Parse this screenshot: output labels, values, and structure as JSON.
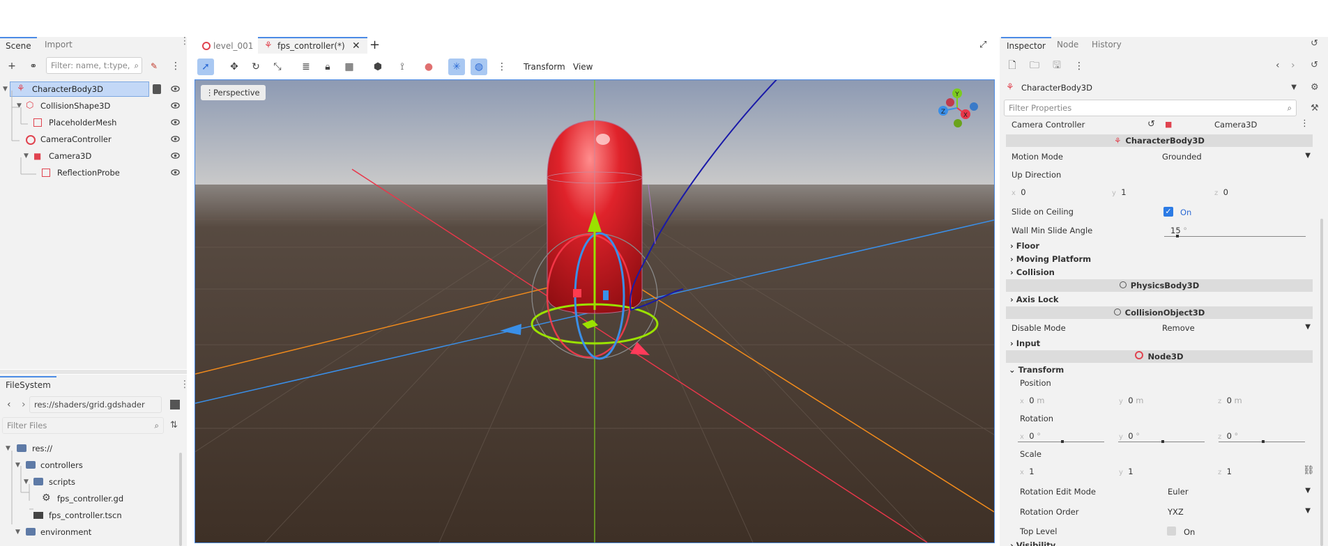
{
  "scene_dock": {
    "tabs": [
      "Scene",
      "Import"
    ],
    "filter_placeholder": "Filter: name, t:type,",
    "nodes": [
      {
        "name": "CharacterBody3D",
        "icon": "character-body-icon",
        "selected": true
      },
      {
        "name": "CollisionShape3D",
        "icon": "collision-shape-icon"
      },
      {
        "name": "PlaceholderMesh",
        "icon": "mesh-icon"
      },
      {
        "name": "CameraController",
        "icon": "node3d-icon"
      },
      {
        "name": "Camera3D",
        "icon": "camera-icon"
      },
      {
        "name": "ReflectionProbe",
        "icon": "reflection-probe-icon"
      }
    ]
  },
  "filesystem": {
    "tab": "FileSystem",
    "path": "res://shaders/grid.gdshader",
    "filter_placeholder": "Filter Files",
    "items": [
      {
        "name": "res://",
        "type": "folder"
      },
      {
        "name": "controllers",
        "type": "folder"
      },
      {
        "name": "scripts",
        "type": "folder"
      },
      {
        "name": "fps_controller.gd",
        "type": "script"
      },
      {
        "name": "fps_controller.tscn",
        "type": "scene"
      },
      {
        "name": "environment",
        "type": "folder"
      }
    ]
  },
  "editor_tabs": {
    "tabs": [
      "level_001",
      "fps_controller(*)"
    ],
    "active": 1
  },
  "viewport_toolbar": {
    "transform_menu": "Transform",
    "view_menu": "View",
    "perspective_label": "Perspective"
  },
  "gizmo_labels": {
    "x": "X",
    "y": "Y",
    "z": "Z"
  },
  "inspector": {
    "tabs": [
      "Inspector",
      "Node",
      "History"
    ],
    "object_name": "CharacterBody3D",
    "filter_placeholder": "Filter Properties",
    "camera_controller": {
      "label": "Camera Controller",
      "value": "Camera3D"
    },
    "sections": {
      "character_body": "CharacterBody3D",
      "physics_body": "PhysicsBody3D",
      "collision_object": "CollisionObject3D",
      "node3d": "Node3D"
    },
    "motion_mode": {
      "label": "Motion Mode",
      "value": "Grounded"
    },
    "up_direction": {
      "label": "Up Direction",
      "x": "0",
      "y": "1",
      "z": "0"
    },
    "slide_on_ceiling": {
      "label": "Slide on Ceiling",
      "value": "On"
    },
    "wall_min_slide_angle": {
      "label": "Wall Min Slide Angle",
      "value": "15",
      "unit": "°"
    },
    "groups": [
      "Floor",
      "Moving Platform",
      "Collision",
      "Axis Lock",
      "Input",
      "Transform",
      "Visibility"
    ],
    "disable_mode": {
      "label": "Disable Mode",
      "value": "Remove"
    },
    "position": {
      "label": "Position",
      "x": "0",
      "y": "0",
      "z": "0",
      "unit": "m"
    },
    "rotation": {
      "label": "Rotation",
      "x": "0",
      "y": "0",
      "z": "0",
      "unit": "°"
    },
    "scale": {
      "label": "Scale",
      "x": "1",
      "y": "1",
      "z": "1"
    },
    "rotation_edit_mode": {
      "label": "Rotation Edit Mode",
      "value": "Euler"
    },
    "rotation_order": {
      "label": "Rotation Order",
      "value": "YXZ"
    },
    "top_level": {
      "label": "Top Level",
      "value": "On"
    }
  },
  "colors": {
    "accent": "#4b8be5",
    "selection": "#c3d8f7",
    "node_red": "#e0434f",
    "ground": "#3e3026",
    "x_axis": "#e8374a",
    "y_axis": "#7ccb1e",
    "z_axis": "#3a8fe8"
  }
}
